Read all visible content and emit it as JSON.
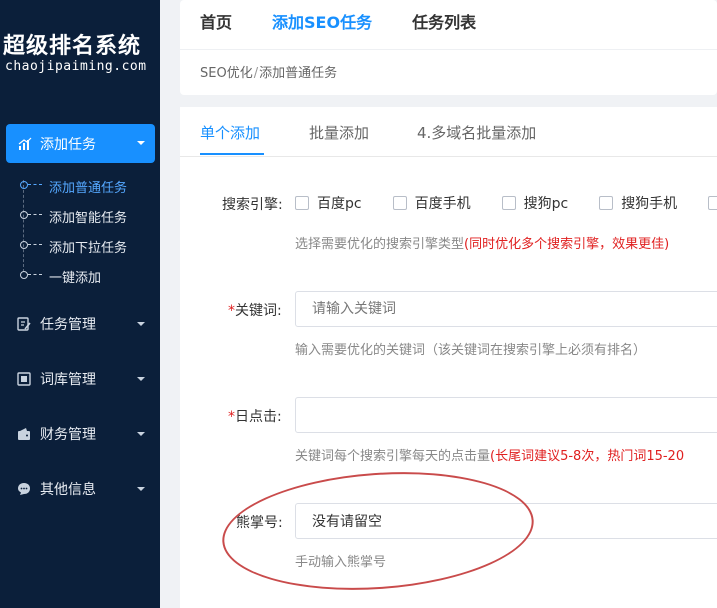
{
  "sidebar": {
    "brand_cn": "超级排名系统",
    "brand_en": "chaojipaiming.com",
    "active_menu": {
      "label": "添加任务",
      "icon": "chart-bars-icon"
    },
    "submenu": [
      {
        "label": "添加普通任务",
        "active": true
      },
      {
        "label": "添加智能任务",
        "active": false
      },
      {
        "label": "添加下拉任务",
        "active": false
      },
      {
        "label": "一键添加",
        "active": false
      }
    ],
    "menus": [
      {
        "label": "任务管理",
        "icon": "edit-note-icon"
      },
      {
        "label": "词库管理",
        "icon": "book-icon"
      },
      {
        "label": "财务管理",
        "icon": "wallet-icon"
      },
      {
        "label": "其他信息",
        "icon": "chat-bubble-icon"
      }
    ]
  },
  "topnav": {
    "items": [
      {
        "label": "首页",
        "active": false
      },
      {
        "label": "添加SEO任务",
        "active": true
      },
      {
        "label": "任务列表",
        "active": false
      }
    ]
  },
  "breadcrumb": {
    "parent": "SEO优化",
    "separator": "/",
    "current": "添加普通任务"
  },
  "tabs": [
    {
      "label": "单个添加",
      "active": true
    },
    {
      "label": "批量添加",
      "active": false
    },
    {
      "label": "4.多域名批量添加",
      "active": false
    }
  ],
  "form": {
    "engine": {
      "label": "搜索引擎:",
      "options": [
        "百度pc",
        "百度手机",
        "搜狗pc",
        "搜狗手机"
      ],
      "hint": "选择需要优化的搜索引擎类型",
      "hint_red": "(同时优化多个搜索引擎，效果更佳)"
    },
    "keyword": {
      "required_mark": "*",
      "label": "关键词:",
      "placeholder": "请输入关键词",
      "hint": "输入需要优化的关键词（该关键词在搜索引擎上必须有排名）"
    },
    "daily_clicks": {
      "required_mark": "*",
      "label": "日点击:",
      "value": "",
      "hint": "关键词每个搜索引擎每天的点击量",
      "hint_red": "(长尾词建议5-8次，热门词15-20"
    },
    "xiongzhang": {
      "label": "熊掌号:",
      "value": "没有请留空",
      "hint": "手动输入熊掌号"
    }
  },
  "colors": {
    "sidebar_bg": "#0b1f3a",
    "accent": "#1890ff",
    "warning": "#e02020",
    "annotation": "#c94b4b"
  }
}
